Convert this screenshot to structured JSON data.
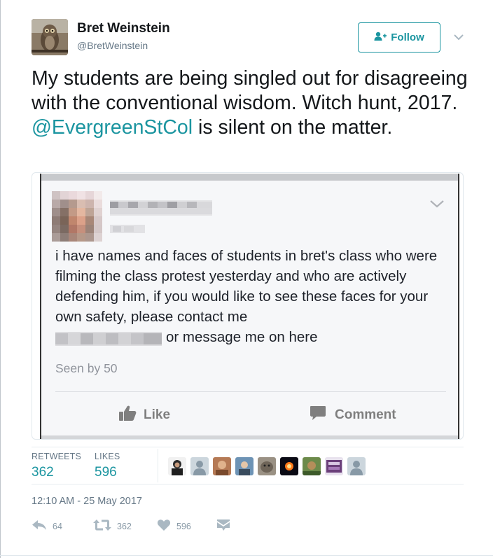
{
  "author": {
    "name": "Bret Weinstein",
    "handle": "@BretWeinstein",
    "avatar_icon": "owl-photo-avatar"
  },
  "follow_button": {
    "label": "Follow",
    "icon": "add-user-icon"
  },
  "tweet": {
    "text_before": "My students are being singled out for disagreeing with the conventional wisdom. Witch hunt, 2017. ",
    "mention": "@EvergreenStCol",
    "text_after": " is silent on the matter."
  },
  "embedded_post": {
    "body_start": "i have names and faces of students in bret's class who were filming the class protest yesterday and who are actively defending him, if you would like to see these faces for your own safety, please contact me",
    "body_end": "or message me on here",
    "seen_by": "Seen by 50",
    "like_label": "Like",
    "comment_label": "Comment"
  },
  "stats": {
    "retweets_label": "RETWEETS",
    "retweets_value": "362",
    "likes_label": "LIKES",
    "likes_value": "596"
  },
  "timestamp": "12:10 AM - 25 May 2017",
  "actions": {
    "reply_count": "64",
    "retweet_count": "362",
    "like_count": "596"
  },
  "colors": {
    "accent": "#1b95a0",
    "text": "#14171a",
    "muted": "#657786",
    "action_icon": "#aab8c2"
  }
}
